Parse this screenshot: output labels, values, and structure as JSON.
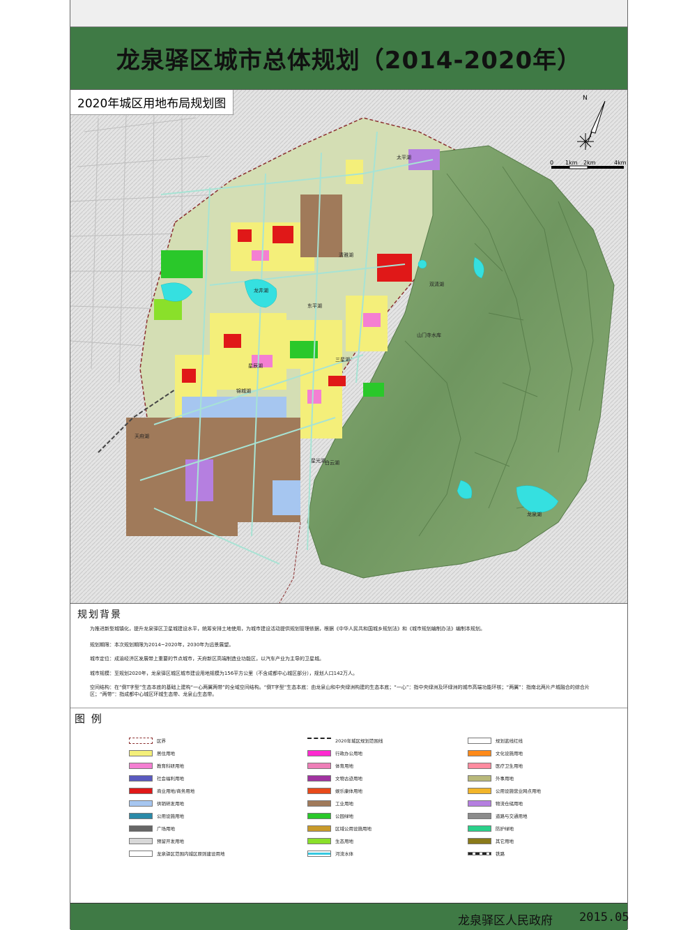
{
  "header": {
    "title": "龙泉驿区城市总体规划（2014-2020年）"
  },
  "map": {
    "subtitle": "2020年城区用地布局规划图",
    "north_label": "N",
    "scale": {
      "ticks": [
        "0",
        "1km",
        "2km",
        "4km"
      ]
    },
    "labels": {
      "l1": "太平湖",
      "l2": "清雅湖",
      "l3": "双清湖",
      "l4": "龙井湖",
      "l5": "东平湖",
      "l6": "山门寺水库",
      "l7": "三星湖",
      "l8": "星辰湖",
      "l9": "锦城湖",
      "l10": "天府湖",
      "l11": "星光湖",
      "l12": "龙泉湖",
      "l13": "白云湖"
    },
    "colors": {
      "background": "#e9e9e9",
      "mountain": "#7fa16a",
      "mountain_dark": "#5f8350",
      "residential": "#f4ef7a",
      "commercial": "#e01818",
      "industrial": "#a07a5a",
      "green": "#3ccc3c",
      "water": "#35e0e0",
      "science": "#f47fd2",
      "logistics": "#b57fe0",
      "road": "#a7e3d4",
      "infrastructure": "#a6c6f0",
      "development": "#d4deb4",
      "boundary": "#8a2e2e"
    }
  },
  "background_section": {
    "heading": "规划背景",
    "paragraphs": [
      "为推进新型城镇化，提升龙泉驿区卫星城建设水平，统筹安排土地使用，为城市建设活动提供规划管理依据，根据《中华人民共和国城乡规划法》和《城市规划编制办法》编制本规划。",
      "规划期限：本次规划期限为2014~2020年，2030年为远景展望。",
      "城市定位：成渝经济区发展带上重要的节点城市，天府新区高端制造业功能区，以汽车产业为主导的卫星城。",
      "城市规模：至规划2020年，龙泉驿区城区城市建设用地规模为156平方公里（不含成都中心城区部分），规划人口142万人。",
      "空间结构：在“倒T字型”生态本底的基础上建构“一心两翼两带”的全域空间结构。“倒T字型”生态本底：由龙泉山和中央绿洲构建的生态本底；“一心”：指中央绿洲及环绿洲的城市高端功能环核；“两翼”：指南北两片产城融合的综合片区；“两带”：指成都中心城区环城生态带、龙泉山生态带。"
    ]
  },
  "legend": {
    "heading": "图 例",
    "items": [
      {
        "label": "区界",
        "color": "#ffffff",
        "style": "dash"
      },
      {
        "label": "2020年城区规划范围线",
        "color": "#ffffff",
        "style": "dashdark"
      },
      {
        "label": "规划蓝线红线",
        "color": "#ffffff",
        "style": "plain"
      },
      {
        "label": "居住用地",
        "color": "#f4ef7a"
      },
      {
        "label": "行政办公用地",
        "color": "#ff2ad0"
      },
      {
        "label": "文化设施用地",
        "color": "#ff8a1a"
      },
      {
        "label": "教育科研用地",
        "color": "#f47fd2"
      },
      {
        "label": "体育用地",
        "color": "#ee7fb8"
      },
      {
        "label": "医疗卫生用地",
        "color": "#ff8ca0"
      },
      {
        "label": "社会福利用地",
        "color": "#5a5abf"
      },
      {
        "label": "文物古迹用地",
        "color": "#a033a0"
      },
      {
        "label": "外事用地",
        "color": "#b8b87a"
      },
      {
        "label": "商业用地/商务用地",
        "color": "#e01818"
      },
      {
        "label": "娱乐康体用地",
        "color": "#e84a1a"
      },
      {
        "label": "公用设施营业网点用地",
        "color": "#f2b52a"
      },
      {
        "label": "供销研发用地",
        "color": "#a6c6f0"
      },
      {
        "label": "工业用地",
        "color": "#a07a5a"
      },
      {
        "label": "物流仓储用地",
        "color": "#b57fe0"
      },
      {
        "label": "公用设施用地",
        "color": "#2a8aa8"
      },
      {
        "label": "公园绿地",
        "color": "#2ac82a"
      },
      {
        "label": "道路与交通用地",
        "color": "#8c8c8c"
      },
      {
        "label": "广场用地",
        "color": "#666666"
      },
      {
        "label": "区域公用设施用地",
        "color": "#c89a2a"
      },
      {
        "label": "防护绿地",
        "color": "#2ad08a"
      },
      {
        "label": "预留开发用地",
        "color": "#d8d8d8"
      },
      {
        "label": "生态用地",
        "color": "#8ae02a"
      },
      {
        "label": "其它用地",
        "color": "#8a7a1a"
      },
      {
        "label": "龙泉驿区范围内城区原则建设用地",
        "color": "#ffffff"
      },
      {
        "label": "河流水体",
        "color": "#35c8e0",
        "style": "water"
      },
      {
        "label": "铁路",
        "color": "#ffffff",
        "style": "rail"
      }
    ]
  },
  "footer": {
    "issuer": "龙泉驿区人民政府",
    "date": "2015.05"
  }
}
